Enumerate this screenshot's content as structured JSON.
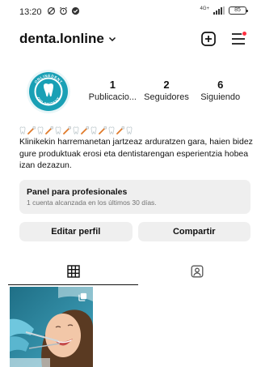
{
  "status_bar": {
    "time": "13:20",
    "network": "4G+",
    "battery": "85"
  },
  "header": {
    "username": "denta.lonline",
    "icons": {
      "add": "plus-square-icon",
      "menu": "hamburger-menu-icon",
      "dropdown": "chevron-down-icon"
    },
    "notification_color": "#ff3040"
  },
  "profile": {
    "avatar": "onlinedent-logo",
    "stats": [
      {
        "value": "1",
        "label": "Publicacio..."
      },
      {
        "value": "2",
        "label": "Seguidores"
      },
      {
        "value": "6",
        "label": "Siguiendo"
      }
    ],
    "bio": {
      "emoji": [
        "tooth",
        "toothbrush",
        "tooth",
        "toothbrush",
        "tooth",
        "toothbrush",
        "tooth",
        "toothbrush",
        "tooth",
        "toothbrush",
        "tooth",
        "toothbrush",
        "tooth"
      ],
      "text": "Klinikekin harremanetan jartzeaz arduratzen gara, haien bidez gure produktuak erosi eta dentistarengan esperientzia hobea izan dezazun."
    }
  },
  "dashboard": {
    "title": "Panel para profesionales",
    "subtitle": "1 cuenta alcanzada en los últimos 30 días."
  },
  "buttons": {
    "edit": "Editar perfil",
    "share": "Compartir"
  },
  "tabs": {
    "grid": "grid-icon",
    "tagged": "tagged-person-icon"
  },
  "posts": [
    {
      "subject": "dental-checkup-photo",
      "multi": true
    }
  ],
  "colors": {
    "accent_teal": "#1aa0b5",
    "button_bg": "#efefef",
    "muted_text": "#737373"
  }
}
